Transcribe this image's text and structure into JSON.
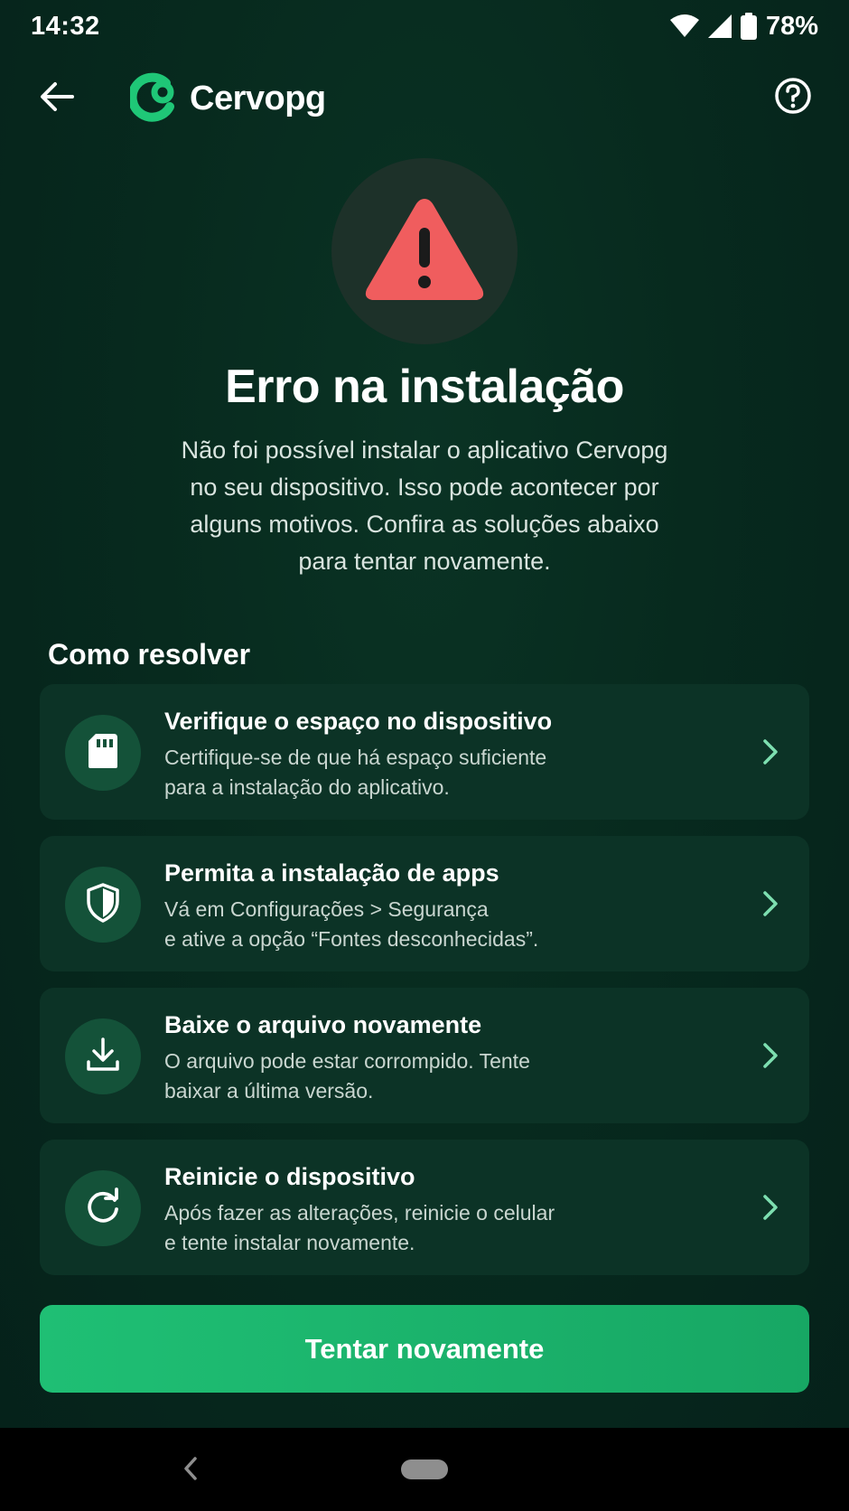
{
  "status_bar": {
    "time": "14:32",
    "battery": "78%",
    "icons": [
      "wifi-icon",
      "signal-icon",
      "battery-icon"
    ]
  },
  "app_bar": {
    "brand_name": "Cervopg",
    "icons": [
      "back-arrow-icon",
      "cervopg-logo-icon",
      "help-icon"
    ]
  },
  "hero": {
    "icon": "warning-triangle-icon",
    "title": "Erro na instalação",
    "description_lines": [
      "Não foi possível instalar o aplicativo Cervopg",
      "no seu dispositivo. Isso pode acontecer por",
      "alguns motivos. Confira as soluções abaixo",
      "para tentar novamente."
    ]
  },
  "section": {
    "title": "Como resolver"
  },
  "items": [
    {
      "icon": "sd-card-icon",
      "title": "Verifique o espaço no dispositivo",
      "line1": "Certifique-se de que há espaço suficiente",
      "line2": "para a instalação do aplicativo."
    },
    {
      "icon": "shield-icon",
      "title": "Permita a instalação de apps",
      "line1": "Vá em Configurações > Segurança",
      "line2": "e ative a opção “Fontes desconhecidas”."
    },
    {
      "icon": "download-icon",
      "title": "Baixe o arquivo novamente",
      "line1": "O arquivo pode estar corrompido. Tente",
      "line2": "baixar a última versão."
    },
    {
      "icon": "refresh-icon",
      "title": "Reinicie o dispositivo",
      "line1": "Após fazer as alterações, reinicie o celular",
      "line2": "e tente instalar novamente."
    }
  ],
  "cta": {
    "label": "Tentar novamente"
  },
  "colors": {
    "background": "#072a1e",
    "card": "#0c3326",
    "icon_circle": "#145239",
    "accent": "#1fbf74",
    "warning": "#f05d5e"
  }
}
